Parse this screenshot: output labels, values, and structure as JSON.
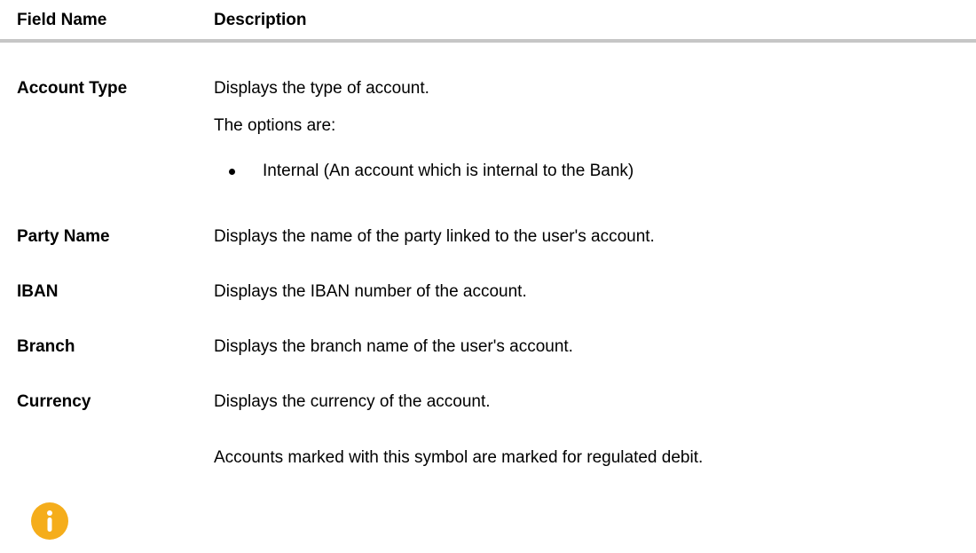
{
  "header": {
    "field_name": "Field Name",
    "description": "Description"
  },
  "rows": [
    {
      "field": "Account Type",
      "lines": [
        "Displays the type of account.",
        "The options are:"
      ],
      "bullets": [
        "Internal (An account which is internal to the Bank)"
      ]
    },
    {
      "field": "Party Name",
      "lines": [
        "Displays the name of the party linked to the user's account."
      ]
    },
    {
      "field": "IBAN",
      "lines": [
        "Displays the IBAN number of the account."
      ]
    },
    {
      "field": "Branch",
      "lines": [
        "Displays the branch name of the user's account."
      ]
    },
    {
      "field": "Currency",
      "lines": [
        "Displays the currency of the account."
      ]
    }
  ],
  "note": {
    "icon": "info-icon",
    "icon_color": "#f5ad1b",
    "text": "Accounts marked with this symbol are marked for regulated debit."
  },
  "colors": {
    "divider": "#c6c6c6",
    "text": "#000000"
  }
}
